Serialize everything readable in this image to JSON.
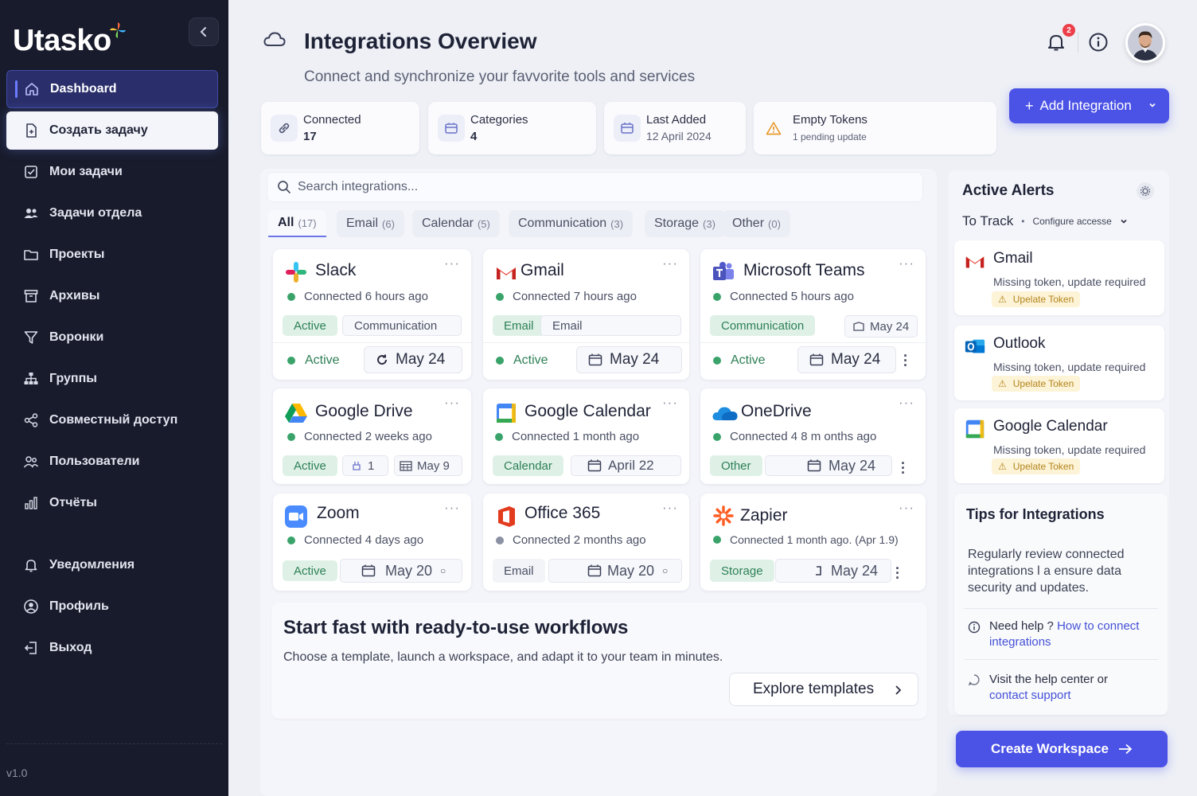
{
  "brand": {
    "name": "Utasko",
    "version": "v1.0"
  },
  "sidebar": {
    "items": [
      {
        "label": "Dashboard",
        "icon": "home-icon"
      },
      {
        "label": "Создать задачу",
        "icon": "file-plus-icon"
      },
      {
        "label": "Мои задачи",
        "icon": "checkbox-icon"
      },
      {
        "label": "Задачи отдела",
        "icon": "users-icon"
      },
      {
        "label": "Проекты",
        "icon": "folder-icon"
      },
      {
        "label": "Архивы",
        "icon": "archive-icon"
      },
      {
        "label": "Воронки",
        "icon": "funnel-icon"
      },
      {
        "label": "Группы",
        "icon": "hierarchy-icon"
      },
      {
        "label": "Совместный доступ",
        "icon": "share-icon"
      },
      {
        "label": "Пользователи",
        "icon": "user-group-icon"
      },
      {
        "label": "Отчёты",
        "icon": "bar-chart-icon"
      }
    ],
    "bottom": [
      {
        "label": "Уведомления",
        "icon": "bell-icon"
      },
      {
        "label": "Профиль",
        "icon": "user-circle-icon"
      },
      {
        "label": "Выход",
        "icon": "logout-icon"
      }
    ]
  },
  "header": {
    "title": "Integrations Overview",
    "subtitle": "Connect and synchronize your favvorite tools and services",
    "notifications_count": "2",
    "add_button": "Add Integration"
  },
  "stats": [
    {
      "label": "Connected",
      "value": "17"
    },
    {
      "label": "Categories",
      "value": "4"
    },
    {
      "label": "Last Added",
      "value": "12 April 2024"
    },
    {
      "label": "Empty Tokens",
      "value": "1 pending update"
    }
  ],
  "search": {
    "placeholder": "Search integrations..."
  },
  "filters": [
    {
      "label": "All",
      "count": "(17)"
    },
    {
      "label": "Email",
      "count": "(6)"
    },
    {
      "label": "Calendar",
      "count": "(5)"
    },
    {
      "label": "Communication",
      "count": "(3)"
    },
    {
      "label": "Storage",
      "count": "(3)"
    },
    {
      "label": "Other",
      "count": "(0)"
    }
  ],
  "integrations": [
    {
      "name": "Slack",
      "connected": "Connected 6 hours ago",
      "tag1": "Active",
      "tag2": "Communication",
      "status": "Active",
      "date": "May 24"
    },
    {
      "name": "Gmail",
      "connected": "Connected 7 hours ago",
      "tag1": "Email",
      "tag2": "Email",
      "status": "Active",
      "date": "May 24"
    },
    {
      "name": "Microsoft Teams",
      "connected": "Connected 5 hours ago",
      "tag1": "Communication",
      "tag2": "May 24",
      "status": "Active",
      "date": "May 24"
    },
    {
      "name": "Google Drive",
      "connected": "Connected 2 weeks ago",
      "tag1": "Active",
      "tag2": "1",
      "date": "May 9"
    },
    {
      "name": "Google Calendar",
      "connected": "Connected 1 month ago",
      "tag1": "Calendar",
      "date": "April 22"
    },
    {
      "name": "OneDrive",
      "connected": "Connected 4 8 m onths ago",
      "tag1": "Other",
      "date": "May 24"
    },
    {
      "name": "Zoom",
      "connected": "Connected 4 days ago",
      "tag1": "Active",
      "date": "May 20"
    },
    {
      "name": "Office 365",
      "connected": "Connected 2 months ago",
      "tag1": "Email",
      "date": "May 20"
    },
    {
      "name": "Zapier",
      "connected": "Connected 1 month ago. (Apr 1.9)",
      "tag1": "Storage",
      "date": "May 24"
    }
  ],
  "banner": {
    "title": "Start fast with ready-to-use workflows",
    "description": "Choose a template, launch a workspace, and adapt it to your team in minutes.",
    "button": "Explore templates"
  },
  "alerts": {
    "title": "Active Alerts",
    "track_label": "To Track",
    "configure": "Configure accesse",
    "items": [
      {
        "name": "Gmail",
        "message": "Missing token, update required",
        "action": "Upelate Token"
      },
      {
        "name": "Outlook",
        "message": "Missing token, update required",
        "action": "Upelate Token"
      },
      {
        "name": "Google Calendar",
        "message": "Missing token, update required",
        "action": "Upelate Token"
      }
    ]
  },
  "tips": {
    "title": "Tips for Integrations",
    "text": "Regularly review connected integrations l a ensure data security and updates.",
    "help_prefix": "Need help ?",
    "help_link": "How to connect integrations",
    "support_prefix": "Visit the help center or",
    "support_link": "contact support"
  },
  "create_workspace": "Create Workspace",
  "colors": {
    "accent": "#4b52e6",
    "sidebar": "#181b2b",
    "success": "#3aa36a",
    "warning": "#b3841c"
  }
}
